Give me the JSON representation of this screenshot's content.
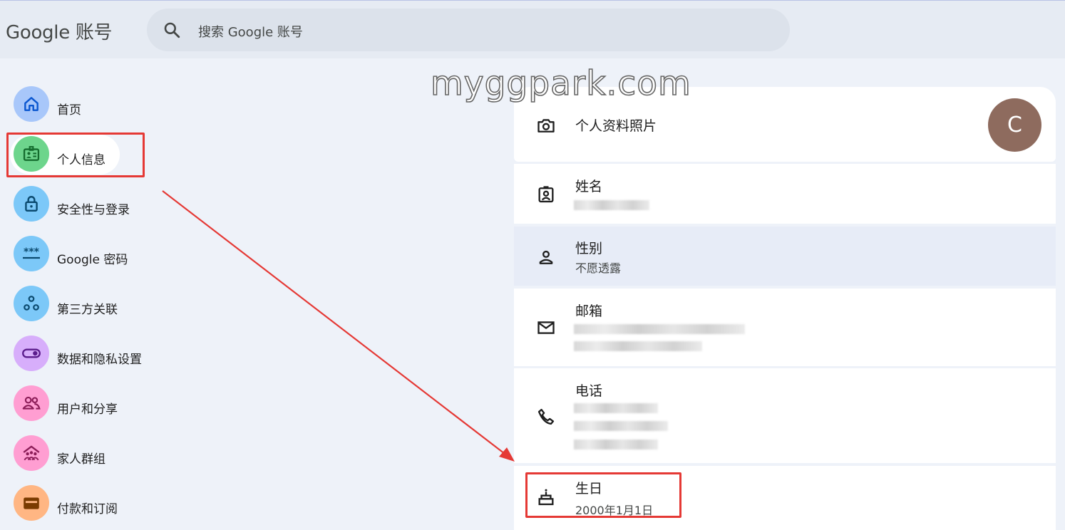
{
  "header": {
    "logo_text": "Google 账号",
    "search_placeholder": "搜索 Google 账号"
  },
  "watermark": "myggpark.com",
  "nav": {
    "items": [
      {
        "label": "首页",
        "icon": "home-icon",
        "color": "#a8c7fa"
      },
      {
        "label": "个人信息",
        "icon": "id-card-icon",
        "color": "#6dd58c"
      },
      {
        "label": "安全性与登录",
        "icon": "lock-icon",
        "color": "#7cc8f8"
      },
      {
        "label": "Google 密码",
        "icon": "password-icon",
        "color": "#7cc8f8"
      },
      {
        "label": "第三方关联",
        "icon": "connections-icon",
        "color": "#7cc8f8"
      },
      {
        "label": "数据和隐私设置",
        "icon": "toggle-icon",
        "color": "#d7aefb"
      },
      {
        "label": "用户和分享",
        "icon": "people-icon",
        "color": "#ff9ed2"
      },
      {
        "label": "家人群组",
        "icon": "family-icon",
        "color": "#ff9ed2"
      },
      {
        "label": "付款和订阅",
        "icon": "wallet-icon",
        "color": "#ffb683"
      }
    ],
    "active_index": 1
  },
  "profile": {
    "photo": {
      "title": "个人资料照片",
      "avatar_letter": "C",
      "avatar_color": "#8e6b5e"
    },
    "name": {
      "title": "姓名"
    },
    "gender": {
      "title": "性别",
      "value": "不愿透露"
    },
    "email": {
      "title": "邮箱"
    },
    "phone": {
      "title": "电话"
    },
    "birthday": {
      "title": "生日",
      "value": "2000年1月1日"
    }
  },
  "colors": {
    "accent_red": "#e53935",
    "highlight_row": "#e7ecf7"
  }
}
